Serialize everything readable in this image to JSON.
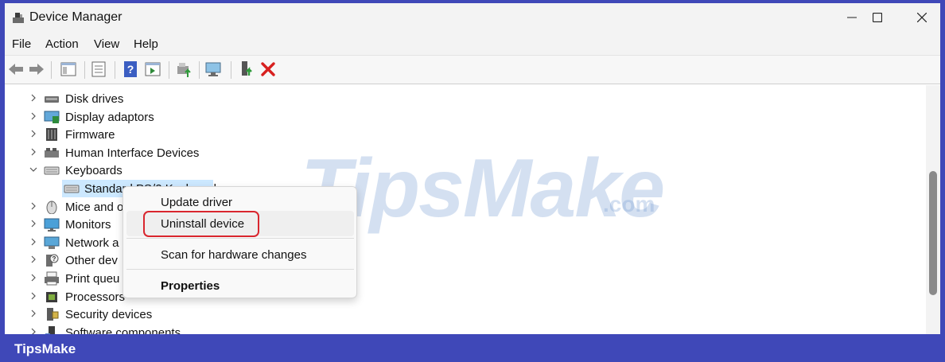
{
  "window": {
    "title": "Device Manager"
  },
  "menu": {
    "items": [
      "File",
      "Action",
      "View",
      "Help"
    ]
  },
  "tree": {
    "items": [
      {
        "label": "Disk drives",
        "icon": "disk-drive-icon",
        "expanded": false
      },
      {
        "label": "Display adaptors",
        "icon": "display-adapter-icon",
        "expanded": false
      },
      {
        "label": "Firmware",
        "icon": "firmware-icon",
        "expanded": false
      },
      {
        "label": "Human Interface Devices",
        "icon": "hid-icon",
        "expanded": false
      },
      {
        "label": "Keyboards",
        "icon": "keyboard-icon",
        "expanded": true
      },
      {
        "label": "Standard PS/2 Keyboard",
        "icon": "keyboard-icon",
        "child": true,
        "selected": true
      },
      {
        "label": "Mice and o",
        "icon": "mouse-icon",
        "expanded": false
      },
      {
        "label": "Monitors",
        "icon": "monitor-icon",
        "expanded": false
      },
      {
        "label": "Network a",
        "icon": "network-adapter-icon",
        "expanded": false
      },
      {
        "label": "Other dev",
        "icon": "other-device-icon",
        "expanded": false
      },
      {
        "label": "Print queu",
        "icon": "printer-icon",
        "expanded": false
      },
      {
        "label": "Processors",
        "icon": "processor-icon",
        "expanded": false
      },
      {
        "label": "Security devices",
        "icon": "security-device-icon",
        "expanded": false
      },
      {
        "label": "Software components",
        "icon": "software-component-icon",
        "expanded": false
      }
    ]
  },
  "context_menu": {
    "update_driver": "Update driver",
    "uninstall_device": "Uninstall device",
    "scan_hardware": "Scan for hardware changes",
    "properties": "Properties"
  },
  "watermark": {
    "brand": "TipsMake",
    "suffix": ".com"
  },
  "footer": {
    "brand": "TipsMake"
  },
  "colors": {
    "frame": "#3f48b8",
    "highlight": "#d9262e",
    "selection": "#cce8ff"
  }
}
